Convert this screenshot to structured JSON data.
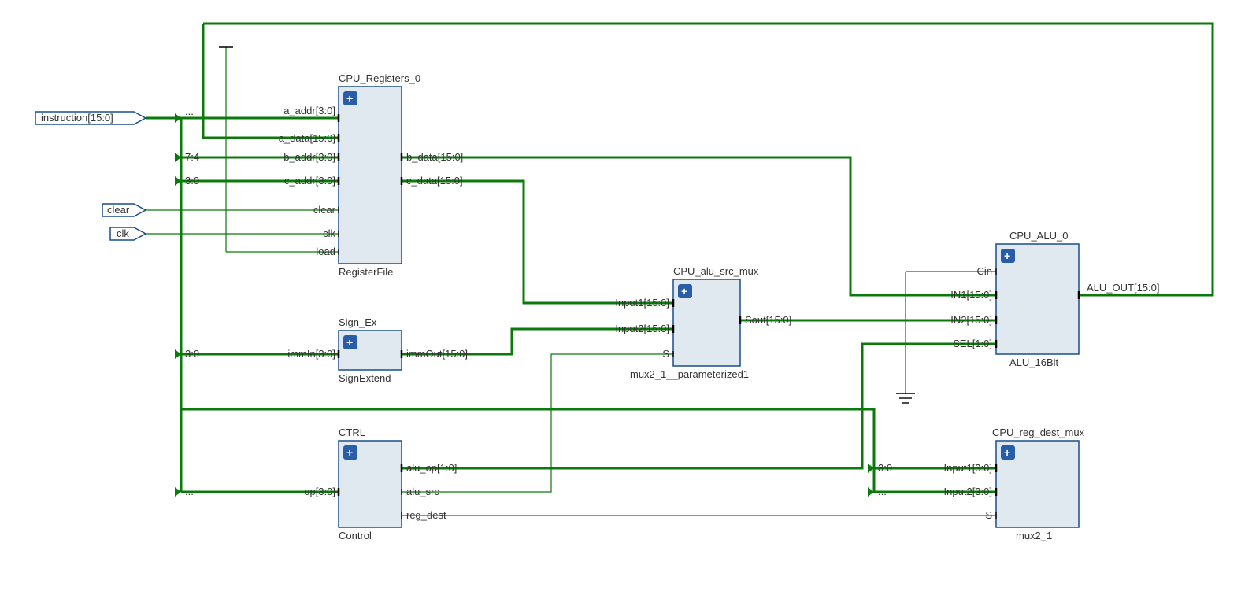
{
  "inputs": {
    "instruction": "instruction[15:0]",
    "clear": "clear",
    "clk": "clk"
  },
  "outputs": {
    "alu_out": "ALU_OUT[15:0]"
  },
  "blocks": {
    "regfile": {
      "title": "CPU_Registers_0",
      "subtitle": "RegisterFile",
      "ports_in": {
        "a_addr": "a_addr[3:0]",
        "a_data": "a_data[15:0]",
        "b_addr": "b_addr[3:0]",
        "c_addr": "c_addr[3:0]",
        "clear": "clear",
        "clk": "clk",
        "load": "load"
      },
      "ports_out": {
        "b_data": "b_data[15:0]",
        "c_data": "c_data[15:0]"
      }
    },
    "signex": {
      "title": "Sign_Ex",
      "subtitle": "SignExtend",
      "ports_in": {
        "immIn": "immIn[3:0]"
      },
      "ports_out": {
        "immOut": "immOut[15:0]"
      }
    },
    "alusrcmux": {
      "title": "CPU_alu_src_mux",
      "subtitle": "mux2_1__parameterized1",
      "ports_in": {
        "in1": "Input1[15:0]",
        "in2": "Input2[15:0]",
        "S": "S"
      },
      "ports_out": {
        "sout": "Sout[15:0]"
      }
    },
    "alu": {
      "title": "CPU_ALU_0",
      "subtitle": "ALU_16Bit",
      "ports_in": {
        "cin": "Cin",
        "in1": "IN1[15:0]",
        "in2": "IN2[15:0]",
        "sel": "SEL[1:0]"
      }
    },
    "ctrl": {
      "title": "CTRL",
      "subtitle": "Control",
      "ports_in": {
        "op": "op[3:0]"
      },
      "ports_out": {
        "alu_op": "alu_op[1:0]",
        "alu_src": "alu_src",
        "reg_dest": "reg_dest"
      }
    },
    "regdestmux": {
      "title": "CPU_reg_dest_mux",
      "subtitle": "mux2_1",
      "ports_in": {
        "in1": "Input1[3:0]",
        "in2": "Input2[3:0]",
        "S": "S"
      }
    }
  },
  "bus_taps": {
    "t74": "7:4",
    "t30a": "3:0",
    "t30b": "3:0",
    "t30c": "3:0",
    "dots1": "...",
    "dots2": "...",
    "dots3": "..."
  }
}
